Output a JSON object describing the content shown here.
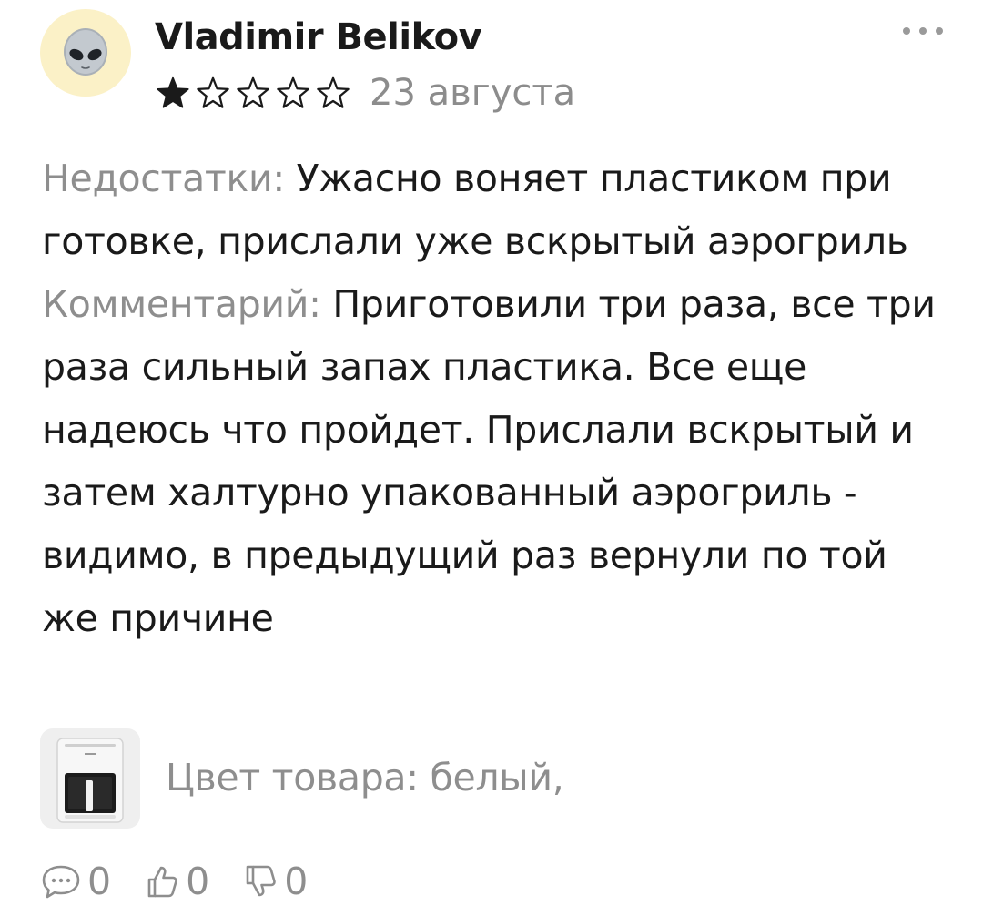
{
  "author": {
    "name": "Vladimir Belikov",
    "avatar_icon": "alien-face-icon",
    "avatar_bg": "#fbf1c7"
  },
  "rating": {
    "value": 1,
    "max": 5,
    "filled_icon": "star-filled-icon",
    "empty_icon": "star-outline-icon"
  },
  "date": "23 августа",
  "more_icon": "ellipsis-icon",
  "review": {
    "cons_label": "Недостатки:",
    "cons_text": "Ужасно воняет пластиком при готовке, прислали уже вскрытый аэрогриль",
    "comment_label": "Комментарий:",
    "comment_text": "Приготовили три раза, все три раза сильный запах пластика. Все еще надеюсь что пройдет. Прислали вскрытый и затем халтурно упакованный аэрогриль - видимо, в предыдущий раз вернули по той же причине"
  },
  "product": {
    "thumb_icon": "air-fryer-thumbnail",
    "variant": "Цвет товара: белый,"
  },
  "actions": {
    "comments": {
      "icon": "comment-icon",
      "count": "0"
    },
    "likes": {
      "icon": "thumbs-up-icon",
      "count": "0"
    },
    "dislikes": {
      "icon": "thumbs-down-icon",
      "count": "0"
    }
  },
  "colors": {
    "text_primary": "#1a1a1a",
    "text_secondary": "#8e8e8e",
    "background": "#ffffff"
  }
}
